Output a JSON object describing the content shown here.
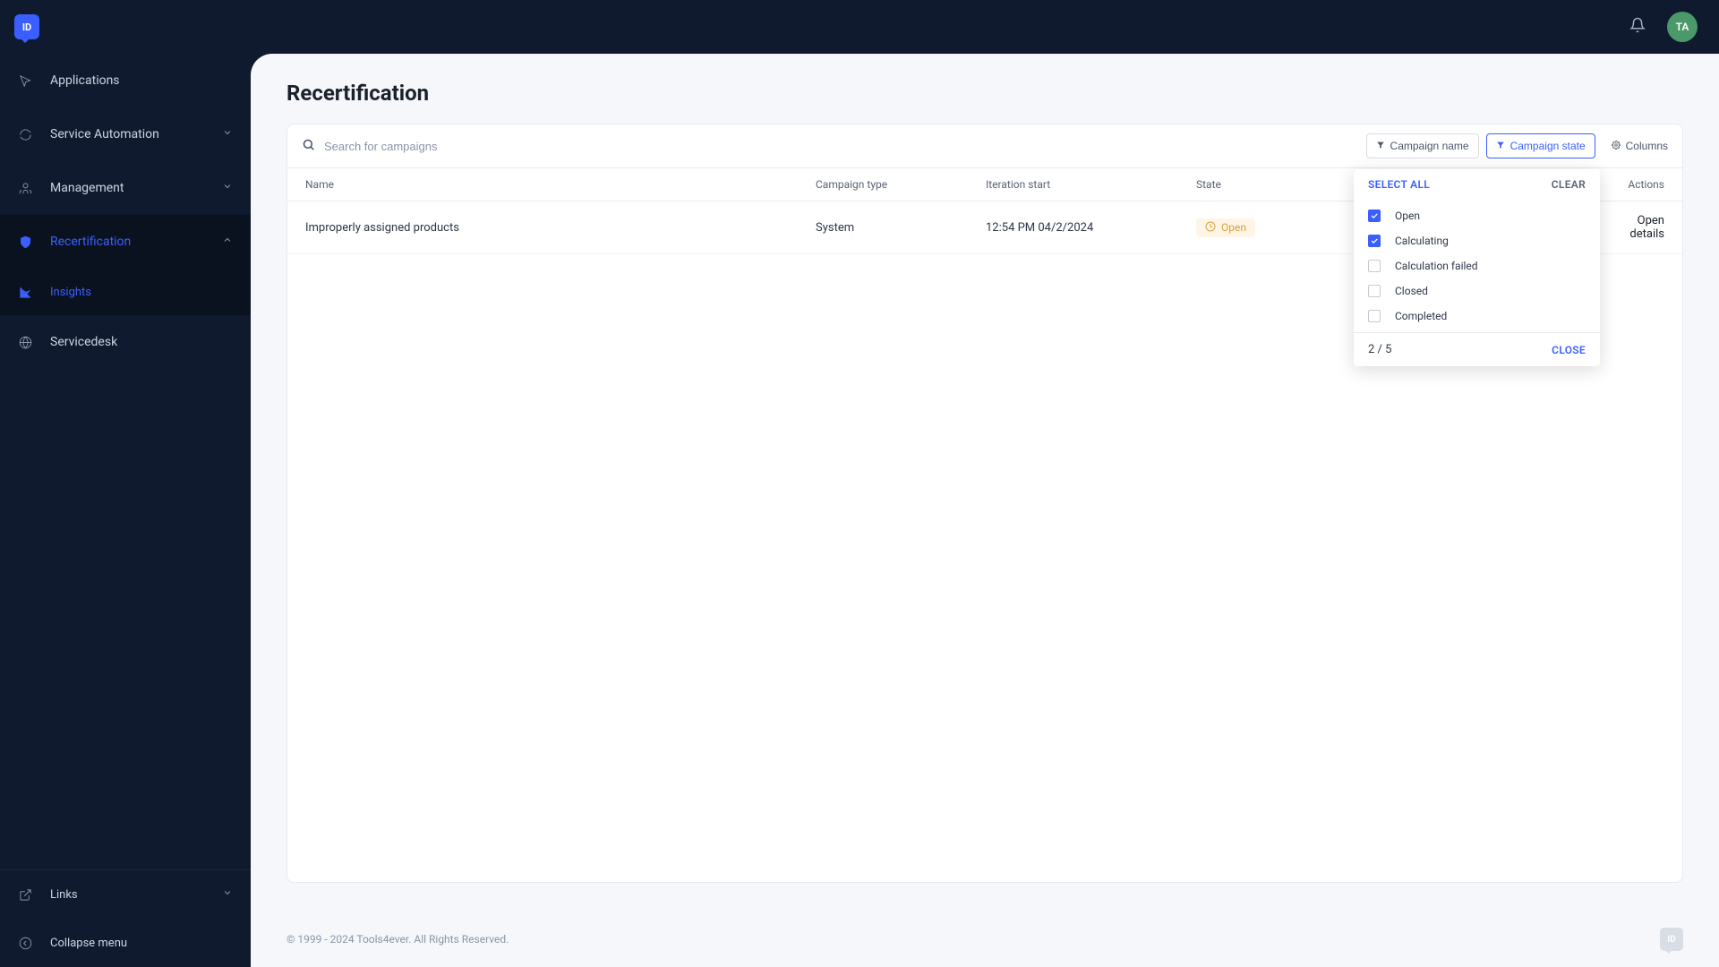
{
  "header": {
    "logo_text": "ID",
    "avatar_text": "TA"
  },
  "sidebar": {
    "items": [
      {
        "label": "Applications",
        "icon": "cursor"
      },
      {
        "label": "Service Automation",
        "icon": "refresh",
        "chevron": "down"
      },
      {
        "label": "Management",
        "icon": "users",
        "chevron": "down"
      },
      {
        "label": "Recertification",
        "icon": "shield",
        "chevron": "up",
        "active": true
      },
      {
        "label": "Insights",
        "icon": "chart",
        "sub": true,
        "active": true
      },
      {
        "label": "Servicedesk",
        "icon": "globe"
      }
    ],
    "footer": {
      "links_label": "Links",
      "collapse_label": "Collapse menu"
    }
  },
  "page": {
    "title": "Recertification"
  },
  "toolbar": {
    "search_placeholder": "Search for campaigns",
    "filter_name_label": "Campaign name",
    "filter_state_label": "Campaign state",
    "columns_label": "Columns"
  },
  "table": {
    "headers": {
      "name": "Name",
      "type": "Campaign type",
      "iteration": "Iteration start",
      "state": "State",
      "actions": "Actions"
    },
    "rows": [
      {
        "name": "Improperly assigned products",
        "type": "System",
        "iteration": "12:54 PM 04/2/2024",
        "state": "Open",
        "action": "Open details"
      }
    ]
  },
  "state_filter": {
    "select_all": "SELECT ALL",
    "clear": "CLEAR",
    "options": [
      {
        "label": "Open",
        "checked": true
      },
      {
        "label": "Calculating",
        "checked": true
      },
      {
        "label": "Calculation failed",
        "checked": false
      },
      {
        "label": "Closed",
        "checked": false
      },
      {
        "label": "Completed",
        "checked": false
      }
    ],
    "count": "2 / 5",
    "close": "CLOSE"
  },
  "footer": {
    "copyright": "© 1999 - 2024 Tools4ever. All Rights Reserved.",
    "logo_text": "ID"
  }
}
